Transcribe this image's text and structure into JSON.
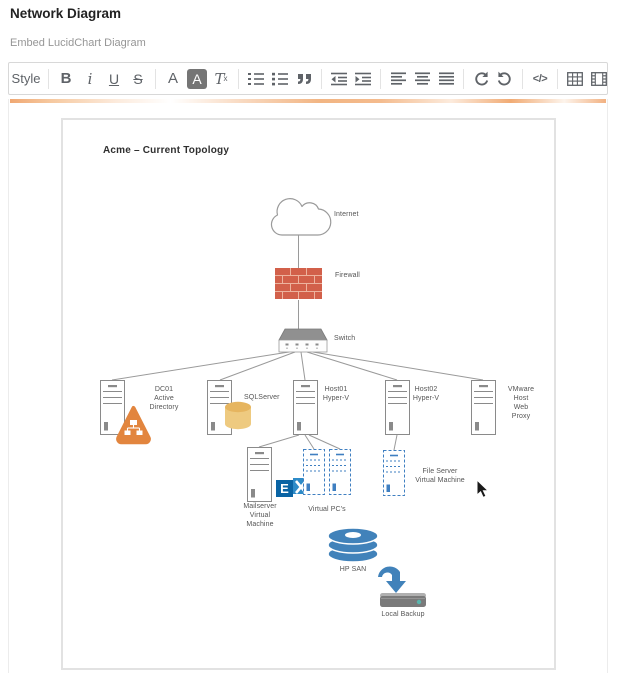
{
  "page": {
    "title": "Network Diagram",
    "subtitle": "Embed LucidChart Diagram"
  },
  "toolbar": {
    "style": "Style",
    "bold": "B",
    "italic": "i",
    "underline": "U",
    "strikethrough": "S",
    "font_color": "A",
    "background_color": "A",
    "clear_main": "T",
    "clear_sub": "x",
    "code": "</>"
  },
  "colors": {
    "selection_orange": "#f0a873",
    "firewall_brick": "#d2604a",
    "firewall_mortar": "#edb39e",
    "active_directory_orange": "#e2853e",
    "sql_cylinder_tan": "#eeca80",
    "exchange_dark_blue": "#0a64a4",
    "exchange_light_blue": "#2e8bc8",
    "virtual_machine_blue": "#3f7fc1",
    "san_blue": "#4182ba",
    "drive_gray": "#7a7a7a",
    "connector_gray": "#9a9a9a"
  },
  "diagram": {
    "title": "Acme – Current Topology",
    "exchange_letter": "E",
    "labels": {
      "internet": "Internet",
      "firewall": "Firewall",
      "switch": "Switch",
      "dc01": "DC01\nActive\nDirectory",
      "sqlserver": "SQLServer",
      "host01": "Host01\nHyper-V",
      "host02": "Host02\nHyper-V",
      "vmware": "VMware Host\nWeb Proxy",
      "mailserver": "Mailserver\nVirtual\nMachine",
      "virtual_pcs": "Virtual PC's",
      "fileserver": "File Server\nVirtual Machine",
      "hp_san": "HP SAN",
      "local_backup": "Local Backup"
    }
  }
}
